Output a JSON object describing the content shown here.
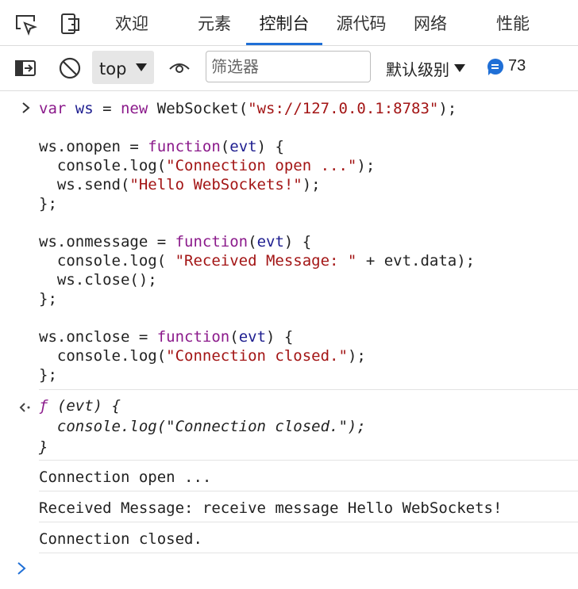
{
  "tabs": [
    {
      "label": "欢迎"
    },
    {
      "label": "元素"
    },
    {
      "label": "控制台"
    },
    {
      "label": "源代码"
    },
    {
      "label": "网络"
    },
    {
      "label": "性能"
    }
  ],
  "active_tab": "控制台",
  "toolbar": {
    "context_value": "top",
    "filter_placeholder": "筛选器",
    "levels_label": "默认级别",
    "issue_count": "73"
  },
  "console": {
    "input_lines": [
      [
        [
          "kw",
          "var "
        ],
        [
          "ident",
          "ws"
        ],
        [
          "plain",
          " = "
        ],
        [
          "kw",
          "new "
        ],
        [
          "plain",
          "WebSocket("
        ],
        [
          "str",
          "\"ws://127.0.0.1:8783\""
        ],
        [
          "plain",
          ");"
        ]
      ],
      [],
      [
        [
          "plain",
          "ws.onopen = "
        ],
        [
          "kw",
          "function"
        ],
        [
          "plain",
          "("
        ],
        [
          "ident",
          "evt"
        ],
        [
          "plain",
          ") {"
        ]
      ],
      [
        [
          "plain",
          "  console.log("
        ],
        [
          "str",
          "\"Connection open ...\""
        ],
        [
          "plain",
          ");"
        ]
      ],
      [
        [
          "plain",
          "  ws.send("
        ],
        [
          "str",
          "\"Hello WebSockets!\""
        ],
        [
          "plain",
          ");"
        ]
      ],
      [
        [
          "plain",
          "};"
        ]
      ],
      [],
      [
        [
          "plain",
          "ws.onmessage = "
        ],
        [
          "kw",
          "function"
        ],
        [
          "plain",
          "("
        ],
        [
          "ident",
          "evt"
        ],
        [
          "plain",
          ") {"
        ]
      ],
      [
        [
          "plain",
          "  console.log( "
        ],
        [
          "str",
          "\"Received Message: \""
        ],
        [
          "plain",
          " + evt.data);"
        ]
      ],
      [
        [
          "plain",
          "  ws.close();"
        ]
      ],
      [
        [
          "plain",
          "};"
        ]
      ],
      [],
      [
        [
          "plain",
          "ws.onclose = "
        ],
        [
          "kw",
          "function"
        ],
        [
          "plain",
          "("
        ],
        [
          "ident",
          "evt"
        ],
        [
          "plain",
          ") {"
        ]
      ],
      [
        [
          "plain",
          "  console.log("
        ],
        [
          "str",
          "\"Connection closed.\""
        ],
        [
          "plain",
          ");"
        ]
      ],
      [
        [
          "plain",
          "};"
        ]
      ]
    ],
    "result_lines": [
      [
        [
          "kw",
          "ƒ "
        ],
        [
          "plain",
          "(evt) {"
        ]
      ],
      [
        [
          "plain",
          "  console.log(\"Connection closed.\");"
        ]
      ],
      [
        [
          "plain",
          "}"
        ]
      ]
    ],
    "log_messages": [
      "Connection open ...",
      "Received Message: receive message Hello WebSockets!",
      "Connection closed."
    ]
  }
}
